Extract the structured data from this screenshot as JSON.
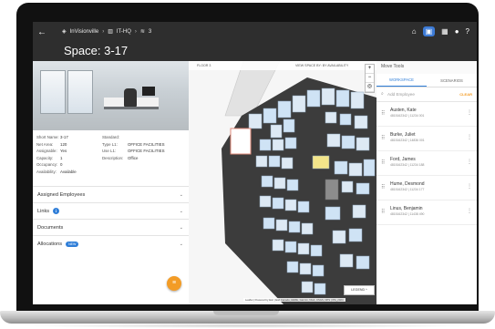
{
  "header": {
    "back_icon": "arrow-left-icon",
    "breadcrumbs": [
      {
        "icon": "site-icon",
        "label": "InVisionville"
      },
      {
        "icon": "building-icon",
        "label": "IT-HQ"
      },
      {
        "icon": "floors-icon",
        "label": "3"
      }
    ],
    "title": "Space: 3-17",
    "icons": [
      "home-icon",
      "map-icon",
      "grid-icon",
      "account-icon",
      "help-icon"
    ]
  },
  "details": {
    "col1": [
      {
        "key": "Short Name:",
        "value": "3-17"
      },
      {
        "key": "Net Area:",
        "value": "120"
      },
      {
        "key": "Assignable:",
        "value": "Yes"
      },
      {
        "key": "Capacity:",
        "value": "1"
      },
      {
        "key": "Occupancy:",
        "value": "0"
      },
      {
        "key": "Availability:",
        "value": "Available"
      }
    ],
    "col2": [
      {
        "key": "Standard:",
        "value": ""
      },
      {
        "key": "Type L1:",
        "value": "OFFICE FACILITIES"
      },
      {
        "key": "Use L1:",
        "value": "OFFICE FACILITIES"
      },
      {
        "key": "Description:",
        "value": "Office"
      }
    ]
  },
  "sections": {
    "assigned": "Assigned Employees",
    "links": "Links",
    "links_badge": "i",
    "documents": "Documents",
    "allocations": "Allocations",
    "allocations_badge": "NEW"
  },
  "map": {
    "floor_label": "FLOOR 3",
    "view_by": "VIEW SPACE BY: BY AVAILABILITY",
    "zoom_in": "+",
    "zoom_out": "−",
    "legend": "LEGEND",
    "attribution": "Leaflet | Powered by Esri | Esri Canada, HERE, Garmin, NGA, USGS, NPS | IPA_2024",
    "colors": {
      "vacant": "#cfe3f5",
      "occupied": "#dde9f4",
      "selected": "#f3e58a",
      "outline": "#e08a7a",
      "corridor": "#3c3c3c"
    }
  },
  "move_tools": {
    "title": "Move Tools",
    "tabs": [
      "WORKSPACE",
      "SCENARIOS"
    ],
    "active_tab": "WORKSPACE",
    "search_placeholder": "Add Employee",
    "clear_label": "CLEAR",
    "employees": [
      {
        "name": "Austen, Kate",
        "sub": "4815162342 | 11234 001"
      },
      {
        "name": "Burke, Juliet",
        "sub": "4815162342 | 14836 001"
      },
      {
        "name": "Ford, James",
        "sub": "4815162342 | 11234 188"
      },
      {
        "name": "Hume, Desmond",
        "sub": "4815162342 | 11234 177"
      },
      {
        "name": "Linus, Benjamin",
        "sub": "4815162342 | 11438 490"
      }
    ]
  }
}
